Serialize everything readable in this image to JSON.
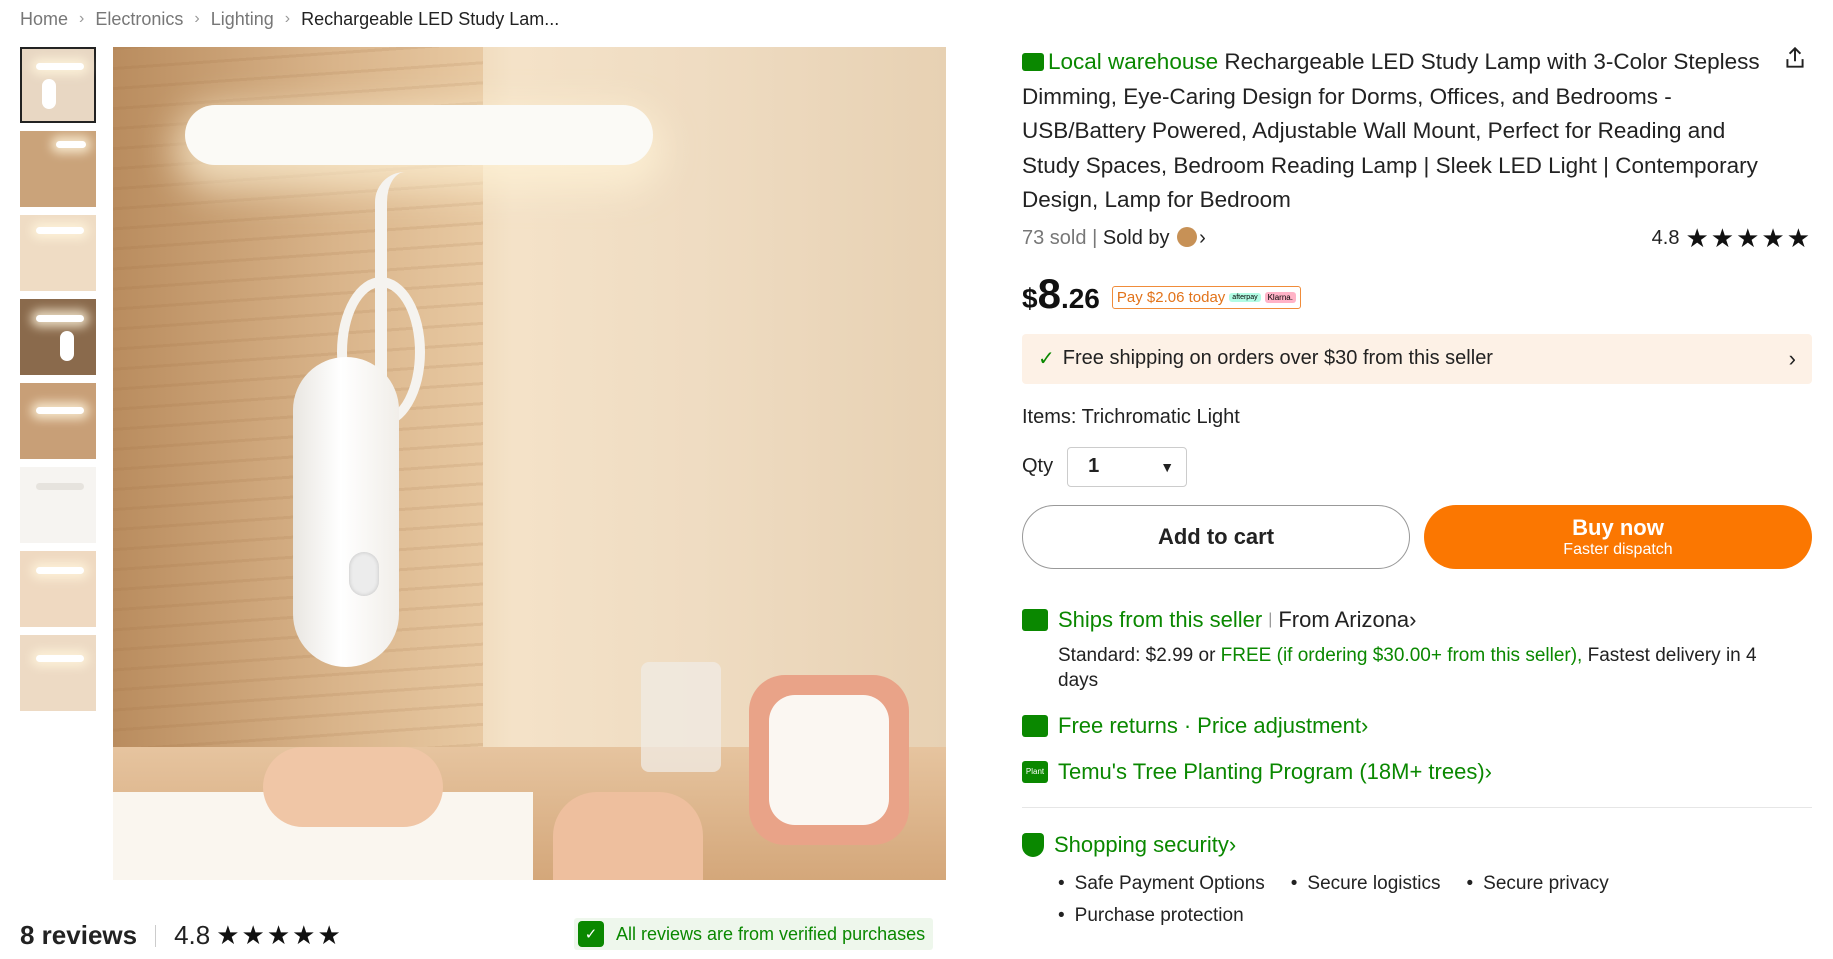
{
  "breadcrumb": {
    "items": [
      "Home",
      "Electronics",
      "Lighting",
      "Rechargeable LED Study Lam..."
    ]
  },
  "thumbnails": {
    "count": 8,
    "active_index": 0
  },
  "reviews": {
    "count_label": "8 reviews",
    "score": "4.8",
    "stars": "★★★★★",
    "verified_label": "All reviews are from verified purchases"
  },
  "product": {
    "badge": "Local warehouse",
    "title": "Rechargeable LED Study Lamp with 3-Color Stepless Dimming, Eye-Caring Design for Dorms, Offices, and Bedrooms - USB/Battery Powered, Adjustable Wall Mount, Perfect for Reading and Study Spaces, Bedroom Reading Lamp | Sleek LED Light | Contemporary Design, Lamp for Bedroom",
    "sold": "73 sold",
    "sold_by": "Sold by",
    "rating": "4.8",
    "stars": "★★★★★",
    "price_currency": "$",
    "price_int": "8",
    "price_dec": ".26",
    "pay_today": "Pay $2.06 today",
    "afterpay_label": "afterpay",
    "klarna_label": "Klarna."
  },
  "shipping_banner": {
    "text": "Free shipping on orders over $30 from this seller"
  },
  "options": {
    "items_label": "Items: Trichromatic Light",
    "qty_label": "Qty",
    "qty_value": "1"
  },
  "actions": {
    "add_to_cart": "Add to cart",
    "buy_now": "Buy now",
    "buy_now_sub": "Faster dispatch"
  },
  "ships": {
    "ships_from": "Ships from this seller",
    "from_location": "From Arizona",
    "standard_prefix": "Standard: $2.99 or ",
    "standard_free": "FREE (if ordering $30.00+ from this seller),",
    "standard_suffix": " Fastest delivery in 4 days",
    "returns": "Free returns",
    "price_adjustment": "Price adjustment",
    "tree_program": "Temu's Tree Planting Program (18M+ trees)",
    "plant_badge": "Plant"
  },
  "security": {
    "title": "Shopping security",
    "items": [
      "Safe Payment Options",
      "Secure logistics",
      "Secure privacy",
      "Purchase protection"
    ]
  },
  "colors": {
    "green": "#0a8800",
    "orange": "#fb7701",
    "banner_bg": "#fdf1e6"
  }
}
